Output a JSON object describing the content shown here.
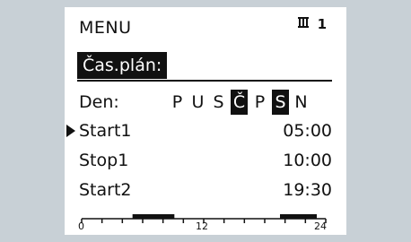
{
  "menu": {
    "title": "MENU",
    "thermostat": "1"
  },
  "subtitle": "Čas.plán:",
  "days": {
    "label": "Den:",
    "items": [
      {
        "letter": "P",
        "selected": false
      },
      {
        "letter": "U",
        "selected": false
      },
      {
        "letter": "S",
        "selected": false
      },
      {
        "letter": "Č",
        "selected": true
      },
      {
        "letter": "P",
        "selected": false
      },
      {
        "letter": "S",
        "selected": true
      },
      {
        "letter": "N",
        "selected": false
      }
    ]
  },
  "rows": [
    {
      "label": "Start1",
      "value": "05:00"
    },
    {
      "label": "Stop1",
      "value": "10:00"
    },
    {
      "label": "Start2",
      "value": "19:30"
    }
  ],
  "timeline": {
    "tick_labels": [
      "0",
      "12",
      "24"
    ],
    "hours": 24,
    "active_periods": [
      [
        5,
        10
      ],
      [
        19.5,
        24
      ]
    ]
  }
}
